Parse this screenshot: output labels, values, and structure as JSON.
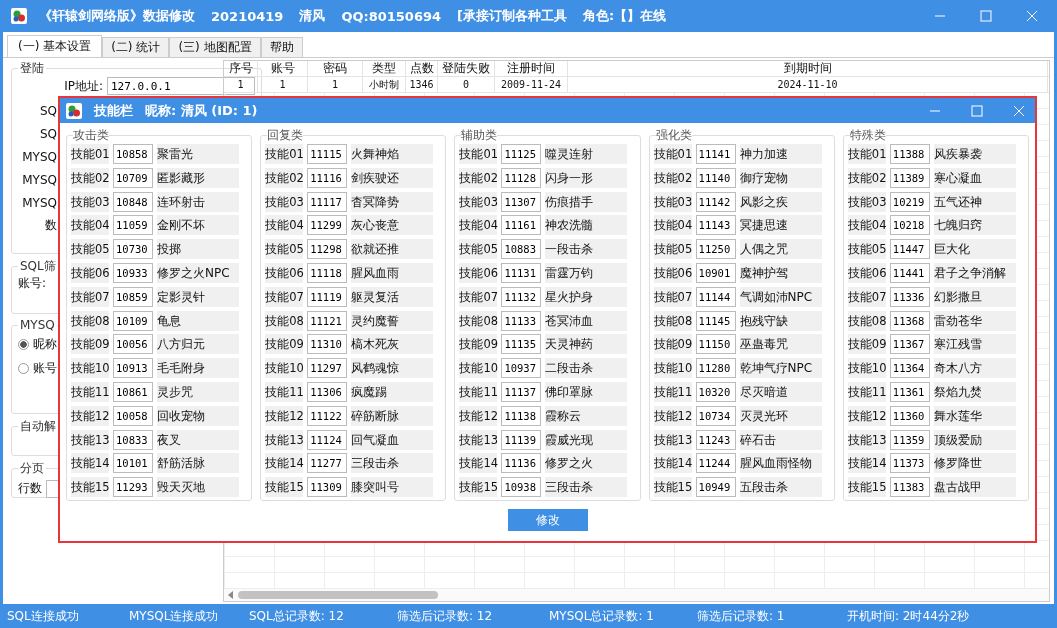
{
  "window": {
    "title_parts": [
      "《轩辕剑网络版》数据修改",
      "20210419",
      "清风",
      "QQ:80150694",
      "[承接订制各种工具",
      "角色:【】在线"
    ]
  },
  "tabs": [
    {
      "label": "(一) 基本设置",
      "selected": true
    },
    {
      "label": "(二) 统计",
      "selected": false
    },
    {
      "label": "(三) 地图配置",
      "selected": false
    },
    {
      "label": "帮助",
      "selected": false
    }
  ],
  "left_panel": {
    "login_group": {
      "title": "登陆",
      "ip_label": "IP地址:",
      "ip_value": "127.0.0.1",
      "labels": [
        "SQ",
        "SQ",
        "MYSQ",
        "MYSQ",
        "MYSQ",
        "数"
      ]
    },
    "sql_filter_group": {
      "title": "SQL筛",
      "account_label": "账号:"
    },
    "mysql_group": {
      "title": "MYSQ",
      "radios": [
        {
          "label": "昵称",
          "selected": true
        },
        {
          "label": "账号",
          "selected": false
        }
      ]
    },
    "auto_group": {
      "title": "自动解"
    },
    "paging_group": {
      "title": "分页",
      "rows_label": "行数"
    }
  },
  "table": {
    "columns": [
      "序号",
      "账号",
      "密码",
      "类型",
      "点数",
      "登陆失败",
      "注册时间",
      "到期时间"
    ],
    "rows": [
      [
        "1",
        "1",
        "1",
        "小时制",
        "1346",
        "0",
        "2009-11-24",
        "2024-11-10"
      ]
    ]
  },
  "dialog": {
    "title": "技能栏",
    "subtitle": "昵称: 清风 (ID: 1)",
    "groups": [
      {
        "title": "攻击类",
        "skills": [
          [
            "技能01",
            "10858",
            "聚雷光"
          ],
          [
            "技能02",
            "10709",
            "匿影藏形"
          ],
          [
            "技能03",
            "10848",
            "连环射击"
          ],
          [
            "技能04",
            "11059",
            "金刚不坏"
          ],
          [
            "技能05",
            "10730",
            "投掷"
          ],
          [
            "技能06",
            "10933",
            "修罗之火NPC"
          ],
          [
            "技能07",
            "10859",
            "定影灵针"
          ],
          [
            "技能08",
            "10109",
            "龟息"
          ],
          [
            "技能09",
            "10056",
            "八方归元"
          ],
          [
            "技能10",
            "10913",
            "毛毛附身"
          ],
          [
            "技能11",
            "10861",
            "灵步咒"
          ],
          [
            "技能12",
            "10058",
            "回收宠物"
          ],
          [
            "技能13",
            "10833",
            "夜叉"
          ],
          [
            "技能14",
            "10101",
            "舒筋活脉"
          ],
          [
            "技能15",
            "11293",
            "毁天灭地"
          ]
        ]
      },
      {
        "title": "回复类",
        "skills": [
          [
            "技能01",
            "11115",
            "火舞神焰"
          ],
          [
            "技能02",
            "11116",
            "剑疾驶还"
          ],
          [
            "技能03",
            "11117",
            "杳冥降势"
          ],
          [
            "技能04",
            "11299",
            "灰心丧意"
          ],
          [
            "技能05",
            "11298",
            "欲就还推"
          ],
          [
            "技能06",
            "11118",
            "腥风血雨"
          ],
          [
            "技能07",
            "11119",
            "躯灵复活"
          ],
          [
            "技能08",
            "11121",
            "灵约魔誓"
          ],
          [
            "技能09",
            "11310",
            "槁木死灰"
          ],
          [
            "技能10",
            "11297",
            "风鹤魂惊"
          ],
          [
            "技能11",
            "11306",
            "疯魔踢"
          ],
          [
            "技能12",
            "11122",
            "碎筋断脉"
          ],
          [
            "技能13",
            "11124",
            "回气凝血"
          ],
          [
            "技能14",
            "11277",
            "三段击杀"
          ],
          [
            "技能15",
            "11309",
            "膝突叫号"
          ]
        ]
      },
      {
        "title": "辅助类",
        "skills": [
          [
            "技能01",
            "11125",
            "噬灵连射"
          ],
          [
            "技能02",
            "11128",
            "闪身一形"
          ],
          [
            "技能03",
            "11307",
            "伤痕措手"
          ],
          [
            "技能04",
            "11161",
            "神农洗髓"
          ],
          [
            "技能05",
            "10883",
            "一段击杀"
          ],
          [
            "技能06",
            "11131",
            "雷霆万钧"
          ],
          [
            "技能07",
            "11132",
            "星火护身"
          ],
          [
            "技能08",
            "11133",
            "苍冥沛血"
          ],
          [
            "技能09",
            "11135",
            "天灵神药"
          ],
          [
            "技能10",
            "10937",
            "二段击杀"
          ],
          [
            "技能11",
            "11137",
            "佛印罩脉"
          ],
          [
            "技能12",
            "11138",
            "霞称云"
          ],
          [
            "技能13",
            "11139",
            "霞威光现"
          ],
          [
            "技能14",
            "11136",
            "修罗之火"
          ],
          [
            "技能15",
            "10938",
            "三段击杀"
          ]
        ]
      },
      {
        "title": "强化类",
        "skills": [
          [
            "技能01",
            "11141",
            "神力加速"
          ],
          [
            "技能02",
            "11140",
            "御疗宠物"
          ],
          [
            "技能03",
            "11142",
            "风影之疾"
          ],
          [
            "技能04",
            "11143",
            "冥捷思速"
          ],
          [
            "技能05",
            "11250",
            "人偶之咒"
          ],
          [
            "技能06",
            "10901",
            "魔神护驾"
          ],
          [
            "技能07",
            "11144",
            "气调如沛NPC"
          ],
          [
            "技能08",
            "11145",
            "抱残守缺"
          ],
          [
            "技能09",
            "11150",
            "巫蛊毒咒"
          ],
          [
            "技能10",
            "11280",
            "乾坤气疗NPC"
          ],
          [
            "技能11",
            "10320",
            "尽灭暗道"
          ],
          [
            "技能12",
            "10734",
            "灭灵光环"
          ],
          [
            "技能13",
            "11243",
            "碎石击"
          ],
          [
            "技能14",
            "11244",
            "腥风血雨怪物"
          ],
          [
            "技能15",
            "10949",
            "五段击杀"
          ]
        ]
      },
      {
        "title": "特殊类",
        "skills": [
          [
            "技能01",
            "11388",
            "风疾暴袭"
          ],
          [
            "技能02",
            "11389",
            "寒心凝血"
          ],
          [
            "技能03",
            "10219",
            "五气还神"
          ],
          [
            "技能04",
            "10218",
            "七魄归窍"
          ],
          [
            "技能05",
            "11447",
            "巨大化"
          ],
          [
            "技能06",
            "11441",
            "君子之争消解"
          ],
          [
            "技能07",
            "11336",
            "幻影撒旦"
          ],
          [
            "技能08",
            "11368",
            "雷劲苍华"
          ],
          [
            "技能09",
            "11367",
            "寒江残雪"
          ],
          [
            "技能10",
            "11364",
            "奇木八方"
          ],
          [
            "技能11",
            "11361",
            "祭焰九焚"
          ],
          [
            "技能12",
            "11360",
            "舞水莲华"
          ],
          [
            "技能13",
            "11359",
            "顶级爱励"
          ],
          [
            "技能14",
            "11373",
            "修罗降世"
          ],
          [
            "技能15",
            "11383",
            "盘古战甲"
          ]
        ]
      }
    ],
    "button": "修改"
  },
  "status_bar": [
    "SQL连接成功",
    "MYSQL连接成功",
    "SQL总记录数: 12",
    "筛选后记录数: 12",
    "MYSQL总记录数: 1",
    "筛选后记录数: 1",
    "开机时间: 2时44分2秒"
  ]
}
